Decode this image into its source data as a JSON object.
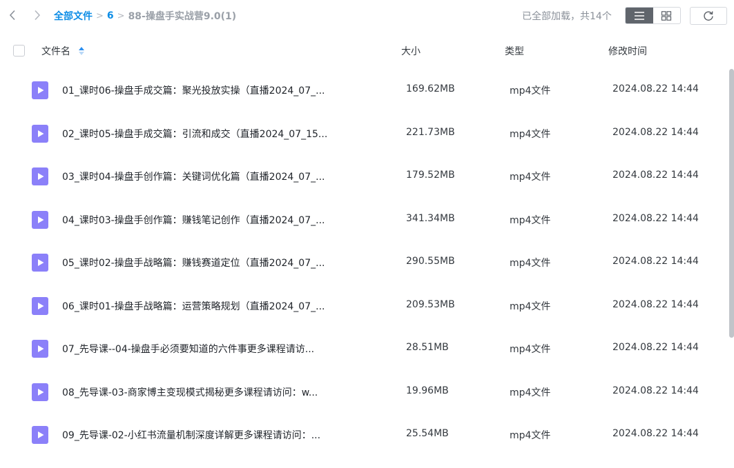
{
  "breadcrumb": {
    "root": "全部文件",
    "sep1": ">",
    "level1": "6",
    "sep2": ">",
    "current": "88-操盘手实战营9.0(1)"
  },
  "status": {
    "load_text": "已全部加载，共14个"
  },
  "header": {
    "name": "文件名",
    "size": "大小",
    "type": "类型",
    "time": "修改时间"
  },
  "icons": {
    "back": "chevron-left-icon",
    "forward": "chevron-right-icon",
    "list_view": "list-view-icon",
    "grid_view": "grid-view-icon",
    "refresh": "refresh-icon",
    "file": "video-file-icon"
  },
  "colors": {
    "accent": "#0d8de6",
    "file_icon": "#8b80f9",
    "active_toggle": "#60656c"
  },
  "files": [
    {
      "name": "01_课时06-操盘手成交篇：聚光投放实操（直播2024_07_...",
      "size": "169.62MB",
      "type": "mp4文件",
      "time": "2024.08.22 14:44"
    },
    {
      "name": "02_课时05-操盘手成交篇：引流和成交（直播2024_07_15...",
      "size": "221.73MB",
      "type": "mp4文件",
      "time": "2024.08.22 14:44"
    },
    {
      "name": "03_课时04-操盘手创作篇：关键词优化篇（直播2024_07_...",
      "size": "179.52MB",
      "type": "mp4文件",
      "time": "2024.08.22 14:44"
    },
    {
      "name": "04_课时03-操盘手创作篇：赚钱笔记创作（直播2024_07_...",
      "size": "341.34MB",
      "type": "mp4文件",
      "time": "2024.08.22 14:44"
    },
    {
      "name": "05_课时02-操盘手战略篇：赚钱赛道定位（直播2024_07_...",
      "size": "290.55MB",
      "type": "mp4文件",
      "time": "2024.08.22 14:44"
    },
    {
      "name": "06_课时01-操盘手战略篇：运营策略规划（直播2024_07_...",
      "size": "209.53MB",
      "type": "mp4文件",
      "time": "2024.08.22 14:44"
    },
    {
      "name": "07_先导课--04-操盘手必须要知道的六件事更多课程请访...",
      "size": "28.51MB",
      "type": "mp4文件",
      "time": "2024.08.22 14:44"
    },
    {
      "name": "08_先导课-03-商家博主变现模式揭秘更多课程请访问：w...",
      "size": "19.96MB",
      "type": "mp4文件",
      "time": "2024.08.22 14:44"
    },
    {
      "name": "09_先导课-02-小红书流量机制深度详解更多课程请访问：...",
      "size": "25.54MB",
      "type": "mp4文件",
      "time": "2024.08.22 14:44"
    }
  ]
}
